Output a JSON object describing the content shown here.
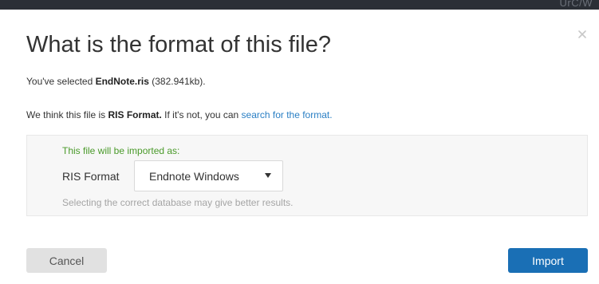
{
  "background": {
    "corner_text": "UrC/W"
  },
  "dialog": {
    "title": "What is the format of this file?",
    "selected_prefix": "You've selected ",
    "file_name": "EndNote.ris",
    "file_size": " (382.941kb).",
    "think_prefix": "We think this file is ",
    "detected_format": "RIS Format.",
    "think_middle": " If it's not, you can ",
    "search_link": "search for the format.",
    "import_as_label": "This file will be imported as:",
    "format_label": "RIS Format",
    "database_select": {
      "selected": "Endnote Windows"
    },
    "hint": "Selecting the correct database may give better results.",
    "cancel_label": "Cancel",
    "import_label": "Import"
  },
  "colors": {
    "accent": "#1a6fb5",
    "link": "#2a7fc4",
    "success_text": "#4a9a2a",
    "hint_text": "#a5a5a5",
    "cancel_bg": "#e1e1e1"
  },
  "icons": {
    "close": "close-icon",
    "dropdown": "chevron-down-icon"
  }
}
